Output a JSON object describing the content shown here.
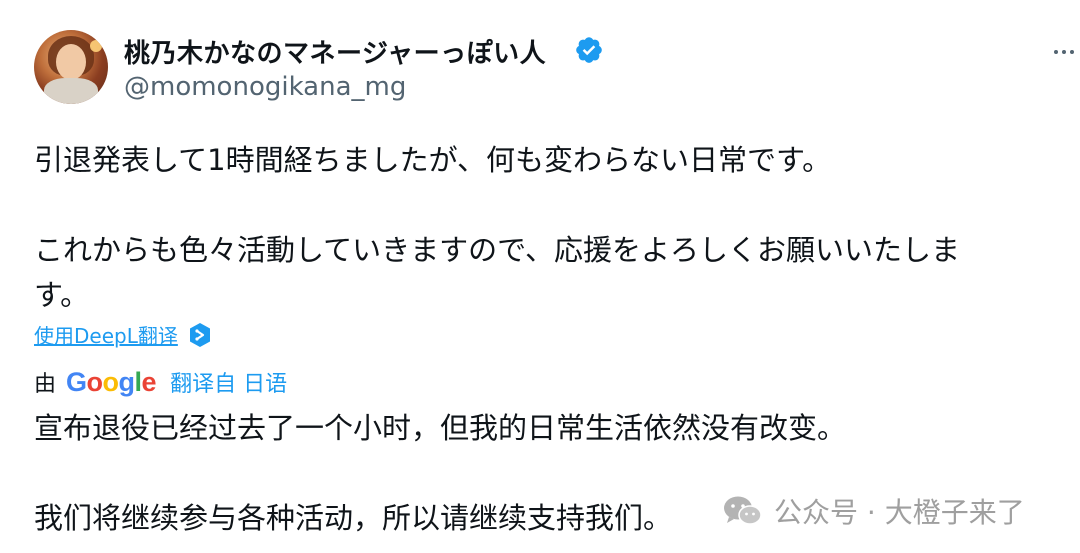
{
  "author": {
    "display_name": "桃乃木かなのマネージャーっぽい人",
    "handle": "@momonogikana_mg"
  },
  "tweet": {
    "text": "引退発表して1時間経ちましたが、何も変わらない日常です。\n\nこれからも色々活動していきますので、応援をよろしくお願いいたしま\nす。"
  },
  "deepl": {
    "label": "使用DeepL翻译"
  },
  "google_translate": {
    "by": "由",
    "logo": [
      "G",
      "o",
      "o",
      "g",
      "l",
      "e"
    ],
    "from_label": "翻译自 日语"
  },
  "translation": {
    "text": "宣布退役已经过去了一个小时，但我的日常生活依然没有改变。\n\n我们将继续参与各种活动，所以请继续支持我们。"
  },
  "watermark": {
    "text": "公众号 · 大橙子来了"
  },
  "colors": {
    "link": "#1d9bf0",
    "secondary_text": "#536471",
    "google_blue": "#4285f4",
    "google_red": "#ea4335",
    "google_yellow": "#fbbc05",
    "google_green": "#34a853"
  }
}
